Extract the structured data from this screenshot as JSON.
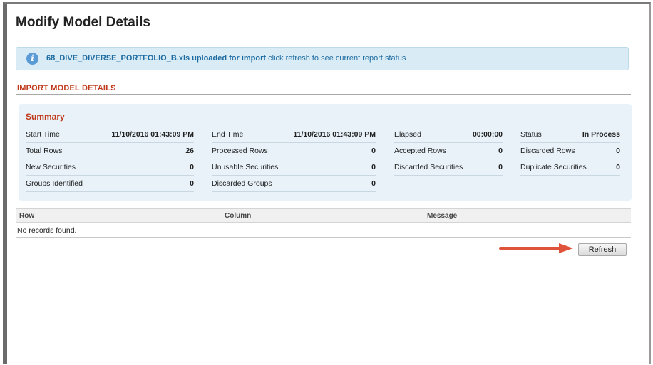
{
  "page": {
    "title": "Modify Model Details"
  },
  "banner": {
    "file": "68_DIVE_DIVERSE_PORTFOLIO_B.xls uploaded for import",
    "message": "click refresh to see current report status",
    "icon": "info-icon"
  },
  "section": {
    "title": "IMPORT MODEL DETAILS"
  },
  "summary": {
    "title": "Summary",
    "start_time_label": "Start Time",
    "start_time_value": "11/10/2016 01:43:09 PM",
    "end_time_label": "End Time",
    "end_time_value": "11/10/2016 01:43:09 PM",
    "elapsed_label": "Elapsed",
    "elapsed_value": "00:00:00",
    "status_label": "Status",
    "status_value": "In Process",
    "total_rows_label": "Total Rows",
    "total_rows_value": "26",
    "processed_rows_label": "Processed Rows",
    "processed_rows_value": "0",
    "accepted_rows_label": "Accepted Rows",
    "accepted_rows_value": "0",
    "discarded_rows_label": "Discarded Rows",
    "discarded_rows_value": "0",
    "new_securities_label": "New Securities",
    "new_securities_value": "0",
    "unusable_securities_label": "Unusable Securities",
    "unusable_securities_value": "0",
    "discarded_securities_label": "Discarded Securities",
    "discarded_securities_value": "0",
    "duplicate_securities_label": "Duplicate Securities",
    "duplicate_securities_value": "0",
    "groups_identified_label": "Groups Identified",
    "groups_identified_value": "0",
    "discarded_groups_label": "Discarded Groups",
    "discarded_groups_value": "0"
  },
  "grid": {
    "columns": [
      "Row",
      "Column",
      "Message"
    ],
    "empty_text": "No records found."
  },
  "actions": {
    "refresh_label": "Refresh"
  },
  "colors": {
    "accent": "#c0391a",
    "banner_text": "#1c6aa0",
    "arrow": "#e0533b"
  }
}
